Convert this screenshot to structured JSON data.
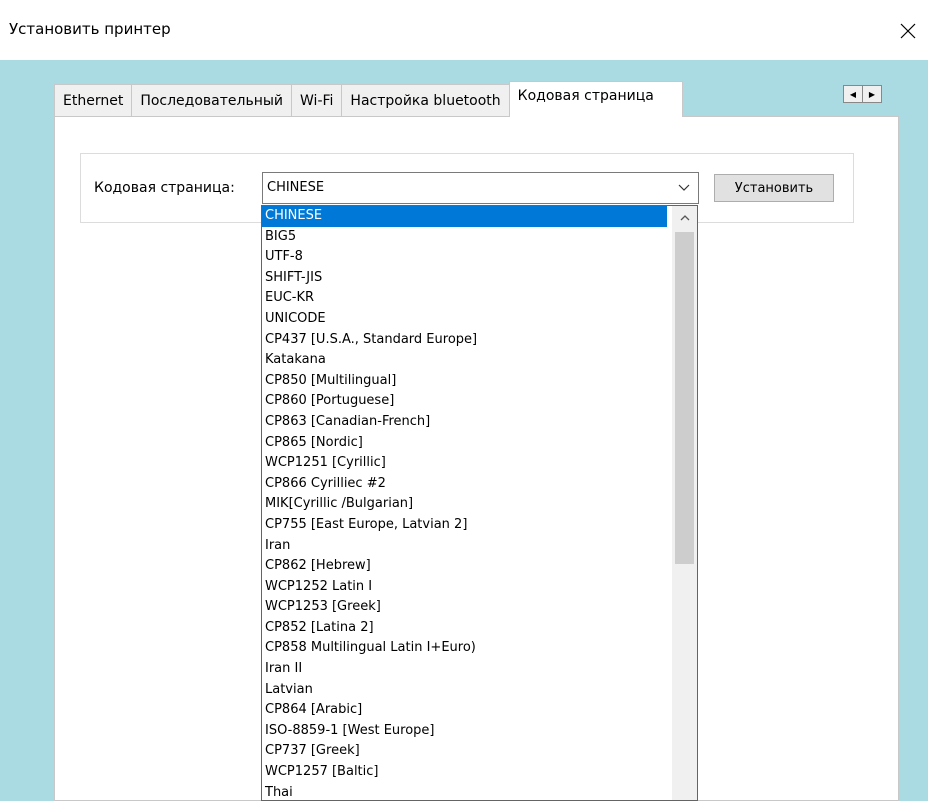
{
  "window": {
    "title": "Установить принтер",
    "close_glyph": "✕"
  },
  "tabs": [
    {
      "label": "Ethernet",
      "active": false
    },
    {
      "label": "Последовательный",
      "active": false
    },
    {
      "label": "Wi-Fi",
      "active": false
    },
    {
      "label": "Настройка bluetooth",
      "active": false
    },
    {
      "label": "Кодовая страница",
      "active": true
    }
  ],
  "tab_scroll": {
    "left_glyph": "◀",
    "right_glyph": "▶"
  },
  "codepage": {
    "label": "Кодовая страница:",
    "selected_value": "CHINESE",
    "install_button": "Установить",
    "options": [
      "CHINESE",
      "BIG5",
      "UTF-8",
      "SHIFT-JIS",
      "EUC-KR",
      "UNICODE",
      "CP437 [U.S.A., Standard Europe]",
      "Katakana",
      "CP850 [Multilingual]",
      "CP860 [Portuguese]",
      "CP863 [Canadian-French]",
      "CP865 [Nordic]",
      "WCP1251 [Cyrillic]",
      "CP866 Cyrilliec #2",
      "MIK[Cyrillic /Bulgarian]",
      "CP755 [East Europe, Latvian 2]",
      "Iran",
      "CP862 [Hebrew]",
      "WCP1252 Latin I",
      "WCP1253 [Greek]",
      "CP852 [Latina 2]",
      "CP858 Multilingual Latin I+Euro)",
      "Iran II",
      "Latvian",
      "CP864 [Arabic]",
      "ISO-8859-1 [West Europe]",
      "CP737 [Greek]",
      "WCP1257 [Baltic]",
      "Thai"
    ]
  },
  "icons": {
    "close": "close-icon",
    "combo_arrow": "chevron-down-icon",
    "scroll_up": "chevron-up-icon"
  },
  "colors": {
    "client_background": "#aadbe3",
    "selection": "#0078d7"
  }
}
